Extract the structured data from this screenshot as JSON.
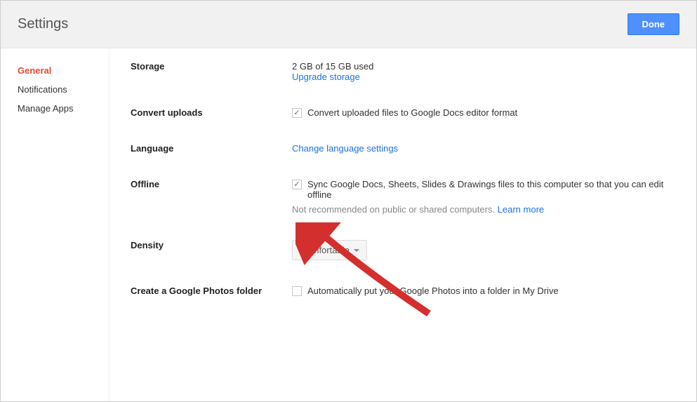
{
  "header": {
    "title": "Settings",
    "done_label": "Done"
  },
  "sidebar": {
    "items": [
      {
        "label": "General",
        "active": true
      },
      {
        "label": "Notifications",
        "active": false
      },
      {
        "label": "Manage Apps",
        "active": false
      }
    ]
  },
  "main": {
    "storage": {
      "label": "Storage",
      "status": "2 GB of 15 GB used",
      "upgrade_link": "Upgrade storage"
    },
    "convert": {
      "label": "Convert uploads",
      "checkbox_label": "Convert uploaded files to Google Docs editor format",
      "checked": true
    },
    "language": {
      "label": "Language",
      "link": "Change language settings"
    },
    "offline": {
      "label": "Offline",
      "checkbox_label": "Sync Google Docs, Sheets, Slides & Drawings files to this computer so that you can edit offline",
      "checked": true,
      "subtext": "Not recommended on public or shared computers. ",
      "learn_more": "Learn more"
    },
    "density": {
      "label": "Density",
      "value": "Comfortable"
    },
    "photos": {
      "label": "Create a Google Photos folder",
      "checkbox_label": "Automatically put your Google Photos into a folder in My Drive",
      "checked": false
    }
  }
}
